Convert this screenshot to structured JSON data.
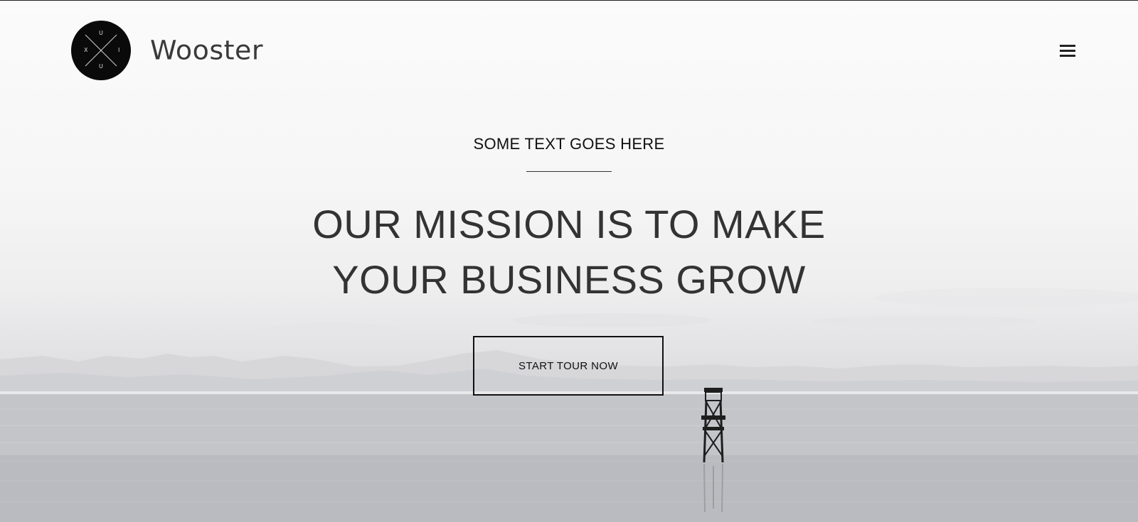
{
  "header": {
    "logo": {
      "letters_top": "U",
      "letters_left": "X",
      "letters_right": "I",
      "letters_bottom": "U"
    },
    "brand_name": "Wooster",
    "menu_icon": "hamburger-menu-icon"
  },
  "hero": {
    "eyebrow": "SOME TEXT GOES HERE",
    "headline_line1": "OUR MISSION IS TO MAKE",
    "headline_line2": "YOUR BUSINESS GROW",
    "cta_label": "START TOUR NOW"
  },
  "colors": {
    "text_dark": "#333333",
    "logo_bg": "#0a0a0a",
    "button_border": "#111111"
  }
}
